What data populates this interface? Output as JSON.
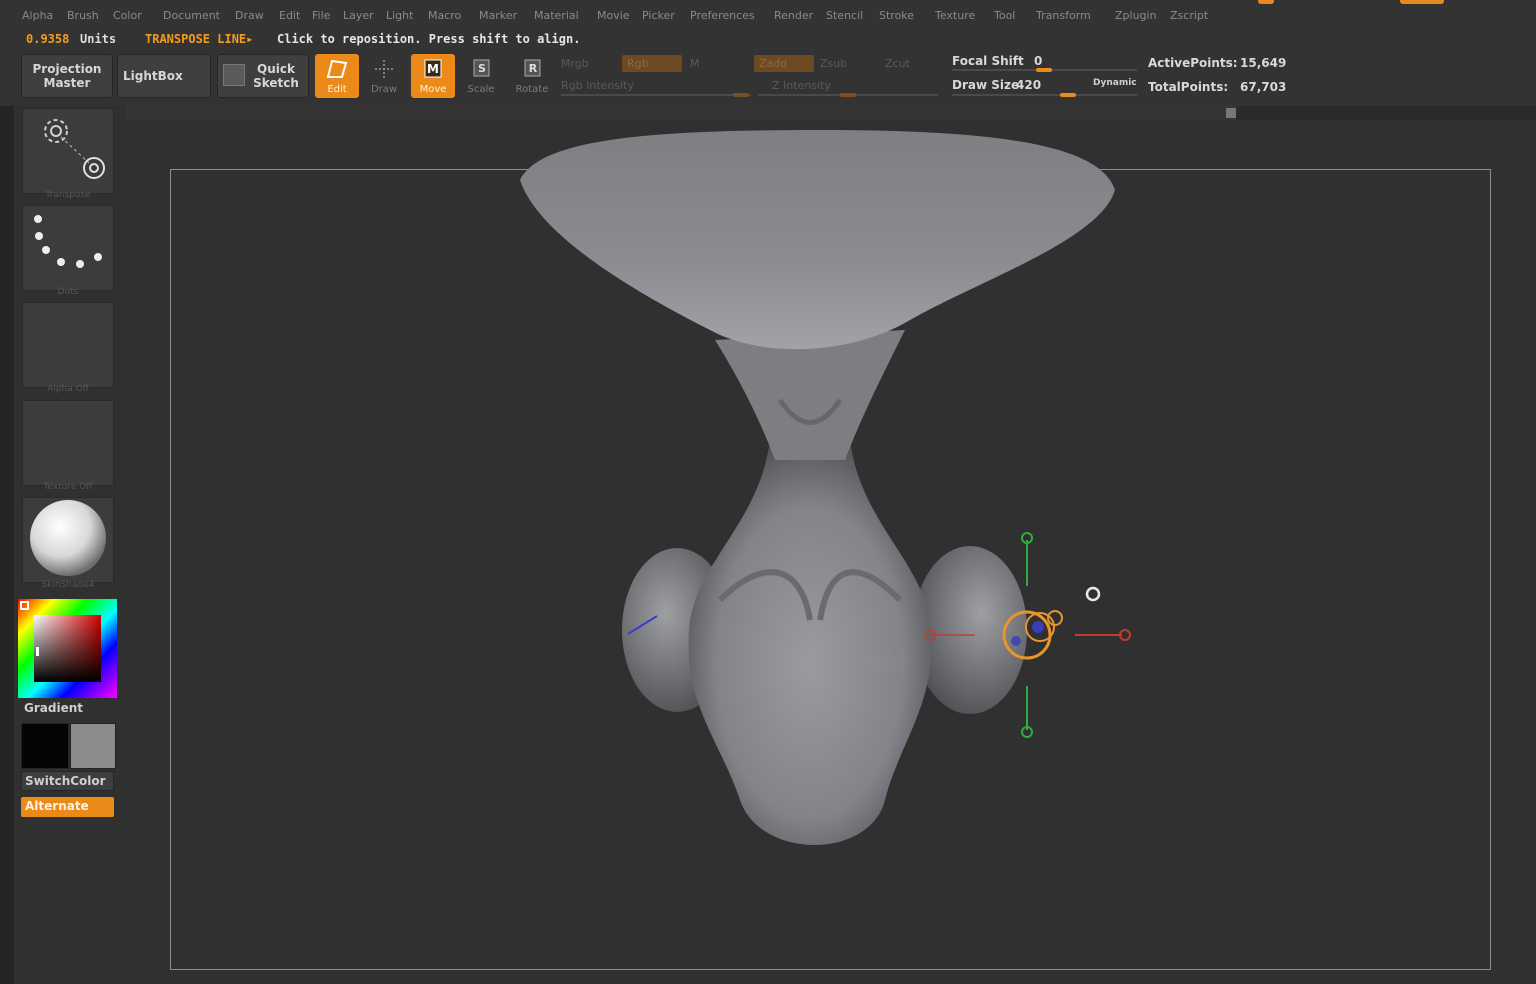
{
  "menu": [
    "Alpha",
    "Brush",
    "Color",
    "Document",
    "Draw",
    "Edit",
    "File",
    "Layer",
    "Light",
    "Macro",
    "Marker",
    "Material",
    "Movie",
    "Picker",
    "Preferences",
    "Render",
    "Stencil",
    "Stroke",
    "Texture",
    "Tool",
    "Transform",
    "Zplugin",
    "Zscript"
  ],
  "status": {
    "units_value": "0.9358",
    "units_label": "Units",
    "transpose_mode": "TRANSPOSE LINE▸",
    "message": "Click to reposition. Press shift to align."
  },
  "shelf": {
    "projection_master": [
      "Projection",
      "Master"
    ],
    "lightbox": "LightBox",
    "quick_sketch": [
      "Quick",
      "Sketch"
    ],
    "tools": [
      {
        "label": "Edit",
        "active": true,
        "icon": "edit-icon"
      },
      {
        "label": "Draw",
        "active": false,
        "icon": "draw-icon"
      },
      {
        "label": "Move",
        "active": true,
        "icon": "move-icon"
      },
      {
        "label": "Scale",
        "active": false,
        "icon": "scale-icon"
      },
      {
        "label": "Rotate",
        "active": false,
        "icon": "rotate-icon"
      }
    ],
    "mrgb": "Mrgb",
    "rgb": "Rgb",
    "m": "M",
    "rgb_intensity": "Rgb Intensity",
    "zadd": "Zadd",
    "zsub": "Zsub",
    "zcut": "Zcut",
    "z_intensity": "Z Intensity",
    "focal_shift_label": "Focal Shift",
    "focal_shift_value": "0",
    "draw_size_label": "Draw Size",
    "draw_size_value": "420",
    "dynamic": "Dynamic",
    "active_points_label": "ActivePoints:",
    "active_points_value": "15,649",
    "total_points_label": "TotalPoints:",
    "total_points_value": "67,703"
  },
  "left": {
    "transpose": "Transpose",
    "dots": "Dots",
    "alpha_off": "Alpha Off",
    "texture_off": "Texture Off",
    "material": "SkinShade4",
    "gradient": "Gradient",
    "switch_color": "SwitchColor",
    "alternate": "Alternate"
  },
  "colors": {
    "accent": "#ec8a19",
    "panel": "#333333",
    "canvas": "#303030",
    "mesh": "#8d8e92"
  }
}
